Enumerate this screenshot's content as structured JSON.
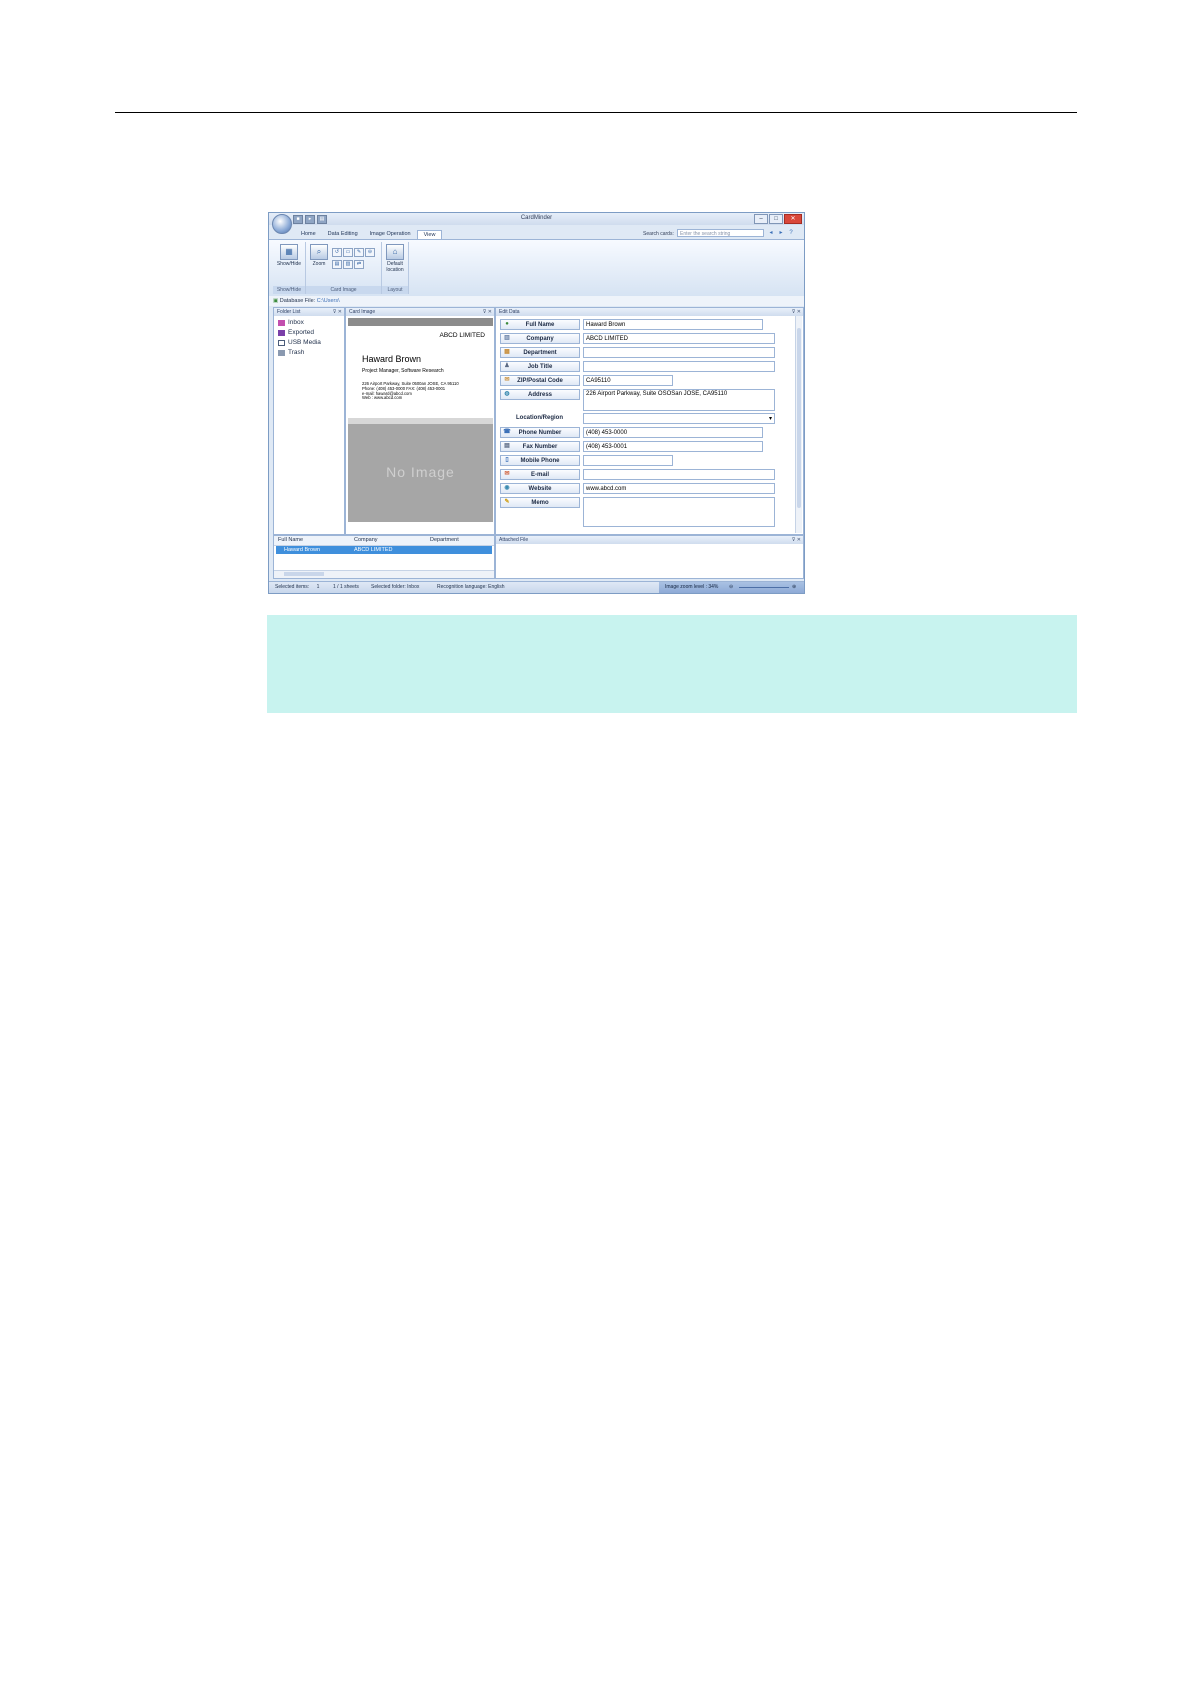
{
  "window": {
    "title": "CardMinder",
    "qat_icons": [
      "save-icon",
      "pointer-icon",
      "print-icon"
    ],
    "controls": {
      "minimize": "–",
      "maximize": "□",
      "close": "✕"
    }
  },
  "ribbon": {
    "tabs": [
      {
        "label": "Home",
        "active": false
      },
      {
        "label": "Data Editing",
        "active": false
      },
      {
        "label": "Image Operation",
        "active": false
      },
      {
        "label": "View",
        "active": true
      }
    ],
    "search_label": "Search cards:",
    "search_placeholder": "Enter the search string",
    "groups": {
      "show_hide": {
        "label": "Show/Hide",
        "button": "Show/Hide"
      },
      "card_image": {
        "label": "Card Image",
        "zoom_button": "Zoom"
      },
      "layout": {
        "label": "Layout",
        "default_location_line1": "Default",
        "default_location_line2": "location"
      }
    }
  },
  "database_bar": {
    "label": "Database File:",
    "path": "C:\\Users\\                                              "
  },
  "folder_list": {
    "title": "Folder List",
    "items": [
      {
        "label": "Inbox",
        "icon": "folder-icon",
        "color": "#c24fae"
      },
      {
        "label": "Exported",
        "icon": "exported-icon",
        "color": "#7a3fa8"
      },
      {
        "label": "USB Media",
        "icon": "usb-icon",
        "color": "#4b5c7a"
      },
      {
        "label": "Trash",
        "icon": "trash-icon",
        "color": "#6d7f99"
      }
    ]
  },
  "card_image": {
    "title": "Card Image",
    "company": "ABCD LIMITED",
    "name": "Haward Brown",
    "job": "Project Manager, Software Research",
    "address_lines": [
      "226 Airport Parkway, Suite 0500an JOSE, CA 95110",
      "Phone: (408) 453-0000       FAX: (408) 453-0001",
      "e-mail: haward@abcd.com",
      "Web   : www.abcd.com"
    ],
    "no_image": "No Image"
  },
  "edit_data": {
    "title": "Edit Data",
    "fields": [
      {
        "label": "Full Name",
        "value": "Haward Brown",
        "icon": "person-icon"
      },
      {
        "label": "Company",
        "value": "ABCD LIMITED",
        "icon": "company-icon"
      },
      {
        "label": "Department",
        "value": "",
        "icon": "department-icon"
      },
      {
        "label": "Job Title",
        "value": "",
        "icon": "job-title-icon"
      },
      {
        "label": "ZIP/Postal Code",
        "value": "CA95110",
        "icon": "zip-icon"
      },
      {
        "label": "Address",
        "value": "226 Airport Parkway, Suite OSOSan JOSE, CA95110",
        "icon": "address-icon"
      },
      {
        "label": "Phone Number",
        "value": "(408) 453-0000",
        "icon": "phone-icon"
      },
      {
        "label": "Fax Number",
        "value": "(408) 453-0001",
        "icon": "fax-icon"
      },
      {
        "label": "Mobile Phone",
        "value": "",
        "icon": "mobile-icon"
      },
      {
        "label": "E-mail",
        "value": "",
        "icon": "email-icon"
      },
      {
        "label": "Website",
        "value": "www.abcd.com",
        "icon": "website-icon"
      },
      {
        "label": "Memo",
        "value": "",
        "icon": "memo-icon"
      }
    ],
    "location_label": "Location/Region",
    "location_value": ""
  },
  "card_list": {
    "columns": [
      "Full Name",
      "Company",
      "Department"
    ],
    "rows": [
      {
        "full_name": "Haward Brown",
        "company": "ABCD LIMITED",
        "department": ""
      }
    ]
  },
  "attached_file": {
    "title": "Attached File"
  },
  "status_bar": {
    "selected_items_label": "Selected items:",
    "selected_items": "1",
    "sheets": "1 / 1 sheets",
    "selected_folder": "Selected folder: Inbox",
    "recognition_language": "Recognition language: English",
    "zoom_level": "Image zoom level : 34%"
  },
  "colors": {
    "accent": "#3f8fdc",
    "note_background": "#c8f3ef"
  }
}
